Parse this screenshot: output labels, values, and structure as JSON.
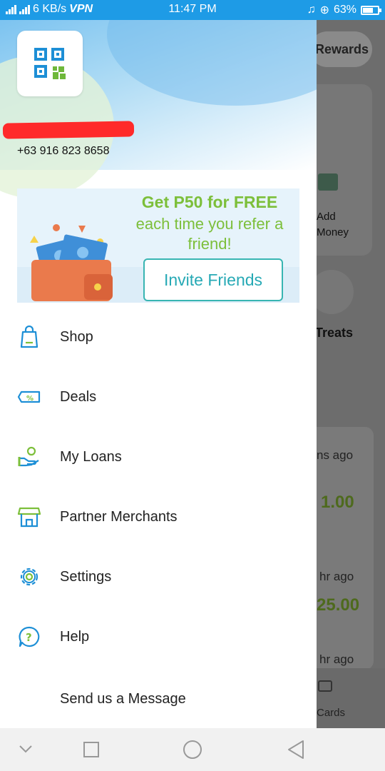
{
  "status_bar": {
    "network_left": "3G",
    "network_right": "4G",
    "speed": "6 KB/s",
    "vpn": "VPN",
    "time": "11:47 PM",
    "battery": "63%"
  },
  "profile": {
    "phone": "+63 916 823 8658"
  },
  "promo": {
    "title": "Get P50 for FREE",
    "subtitle": "each time you refer a friend!",
    "button": "Invite Friends"
  },
  "menu": [
    {
      "label": "Shop",
      "icon": "shopping-bag-icon"
    },
    {
      "label": "Deals",
      "icon": "ticket-percent-icon"
    },
    {
      "label": "My Loans",
      "icon": "hand-coin-icon"
    },
    {
      "label": "Partner Merchants",
      "icon": "storefront-icon"
    },
    {
      "label": "Settings",
      "icon": "gear-icon"
    },
    {
      "label": "Help",
      "icon": "question-icon"
    },
    {
      "label": "Send us a Message",
      "icon": ""
    }
  ],
  "background_app": {
    "rewards": "Rewards",
    "add_money": "Add\nMoney",
    "treats": "Treats",
    "time_1": "ns ago",
    "amount_1": "1.00",
    "time_2": "hr ago",
    "amount_2": "25.00",
    "time_3": "hr ago",
    "cards": "Cards"
  },
  "colors": {
    "status_bar": "#1e9be6",
    "accent_blue": "#1d8fd6",
    "promo_green": "#7cbf3a",
    "invite_teal": "#26a9b5"
  }
}
